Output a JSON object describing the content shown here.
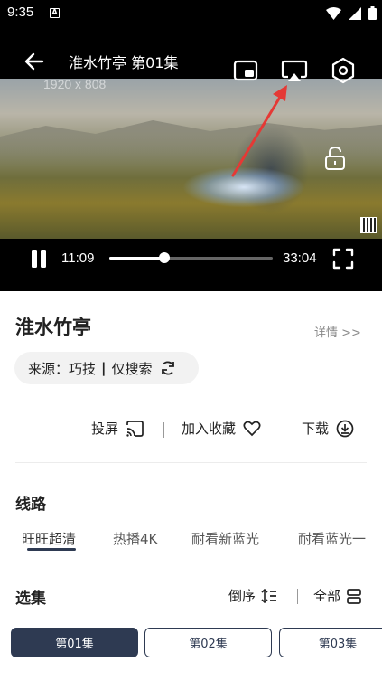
{
  "status_bar": {
    "time": "9:35",
    "notification_icon_letter": "A",
    "icons": [
      "wifi-icon",
      "cellular-icon",
      "battery-icon"
    ]
  },
  "player": {
    "title": "淮水竹亭 第01集",
    "resolution": "1920 x 808",
    "current_time": "11:09",
    "total_time": "33:04",
    "progress": 0.337,
    "top_icons": [
      "picture-in-picture-icon",
      "cast-airplay-icon",
      "settings-hexagon-icon"
    ],
    "annotation_arrow_color": "#e53935"
  },
  "show": {
    "title": "淮水竹亭",
    "details_link": "详情 >>",
    "source_prefix": "来源：巧技",
    "source_sep": "|",
    "source_suffix": "仅搜索"
  },
  "actions": {
    "cast": "投屏",
    "favorite": "加入收藏",
    "download": "下载"
  },
  "lines_section": {
    "title": "线路",
    "items": [
      "旺旺超清",
      "热播4K",
      "耐看新蓝光",
      "耐看蓝光一"
    ],
    "active_index": 0
  },
  "episodes_section": {
    "title": "选集",
    "sort_label": "倒序",
    "all_label": "全部",
    "episodes": [
      "第01集",
      "第02集",
      "第03集"
    ],
    "active_index": 0
  },
  "colors": {
    "accent": "#2e3a52",
    "player_bg": "#000000"
  }
}
